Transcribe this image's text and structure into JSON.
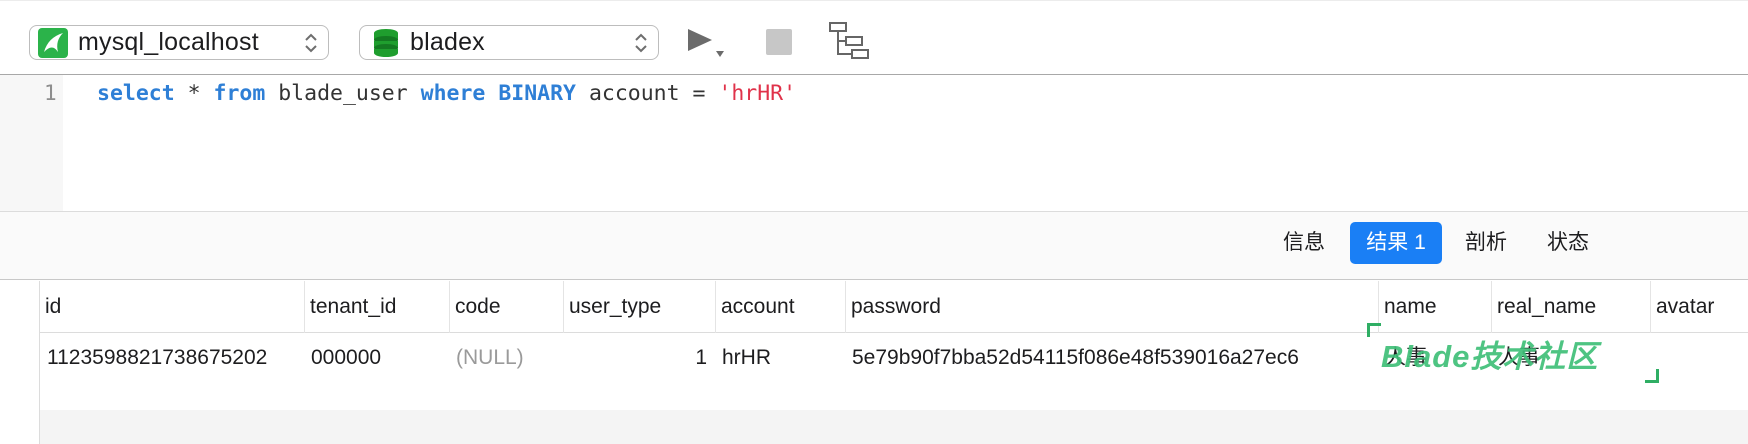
{
  "toolbar": {
    "connection": "mysql_localhost",
    "database": "bladex",
    "icons": [
      "mysql-connection-icon",
      "database-icon",
      "run-icon",
      "stop-icon",
      "explain-icon"
    ]
  },
  "editor": {
    "line_number": "1",
    "tokens": {
      "t1": "select",
      "t2": " * ",
      "t3": "from",
      "t4": " blade_user ",
      "t5": "where",
      "t6": " ",
      "t7": "BINARY",
      "t8": " account = ",
      "t9": "'hrHR'"
    }
  },
  "tabs": [
    {
      "label": "信息"
    },
    {
      "label": "结果 1",
      "active": true
    },
    {
      "label": "剖析"
    },
    {
      "label": "状态"
    }
  ],
  "grid": {
    "columns": [
      "id",
      "tenant_id",
      "code",
      "user_type",
      "account",
      "password",
      "name",
      "real_name",
      "avatar"
    ],
    "rows": [
      {
        "id": "1123598821738675202",
        "tenant_id": "000000",
        "code": "(NULL)",
        "user_type": "1",
        "account": "hrHR",
        "password": "5e79b90f7bba52d54115f086e48f539016a27ec6",
        "name": "人事",
        "real_name": "人事",
        "avatar": ""
      }
    ]
  },
  "watermark": {
    "text": "Blade技术社区"
  },
  "colors": {
    "accent": "#1a7ff5",
    "keyword": "#2e7fd6",
    "string": "#e0324a",
    "watermark": "#3fbf78"
  }
}
